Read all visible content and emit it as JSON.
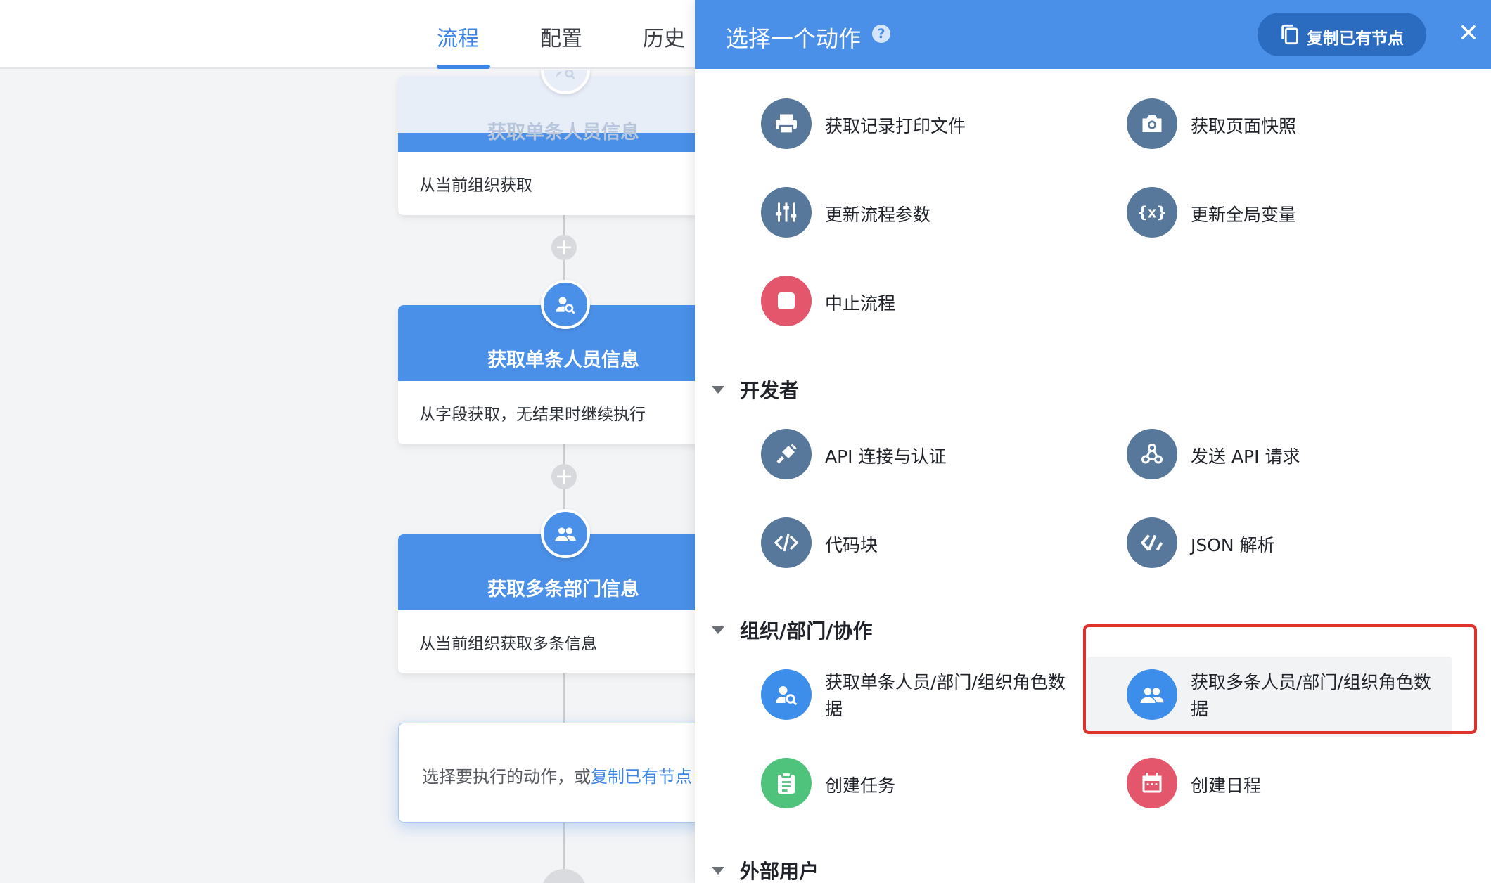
{
  "editor": {
    "tabs": [
      {
        "label": "流程",
        "active": true
      },
      {
        "label": "配置",
        "active": false
      },
      {
        "label": "历史",
        "active": false
      }
    ],
    "nodes": [
      {
        "title": "获取单条人员信息",
        "desc": "从当前组织获取"
      },
      {
        "title": "获取单条人员信息",
        "desc": "从字段获取，无结果时继续执行"
      },
      {
        "title": "获取多条部门信息",
        "desc": "从当前组织获取多条信息"
      }
    ],
    "pick_card": {
      "text": "选择要执行的动作，或",
      "link": "复制已有节点"
    }
  },
  "panel": {
    "title": "选择一个动作",
    "copy_button": "复制已有节点",
    "actions_top": [
      {
        "label": "获取记录打印文件",
        "icon": "printer-icon",
        "color": "#57789b"
      },
      {
        "label": "获取页面快照",
        "icon": "camera-icon",
        "color": "#57789b"
      },
      {
        "label": "更新流程参数",
        "icon": "sliders-icon",
        "color": "#57789b"
      },
      {
        "label": "更新全局变量",
        "icon": "variable-icon",
        "color": "#57789b"
      },
      {
        "label": "中止流程",
        "icon": "stop-icon",
        "color": "#e4566b"
      }
    ],
    "sections": [
      {
        "title": "开发者",
        "actions": [
          {
            "label": "API 连接与认证",
            "icon": "plug-icon"
          },
          {
            "label": "发送 API 请求",
            "icon": "webhook-icon"
          },
          {
            "label": "代码块",
            "icon": "code-icon"
          },
          {
            "label": "JSON 解析",
            "icon": "json-icon"
          }
        ]
      },
      {
        "title": "组织/部门/协作",
        "actions": [
          {
            "label": "获取单条人员/部门/组织角色数据",
            "icon": "user-search-icon"
          },
          {
            "label": "获取多条人员/部门/组织角色数据",
            "icon": "users-icon",
            "highlighted": true
          },
          {
            "label": "创建任务",
            "icon": "clipboard-icon"
          },
          {
            "label": "创建日程",
            "icon": "calendar-icon"
          }
        ]
      },
      {
        "title": "外部用户",
        "actions": []
      }
    ]
  },
  "colors": {
    "primary": "#4a90e8",
    "accent_dark": "#2b6bc0",
    "slate_icon": "#57789b",
    "stop_red": "#e4566b",
    "org_blue": "#3d8eea",
    "task_green": "#4fc27c",
    "highlight": "#e0322a"
  }
}
